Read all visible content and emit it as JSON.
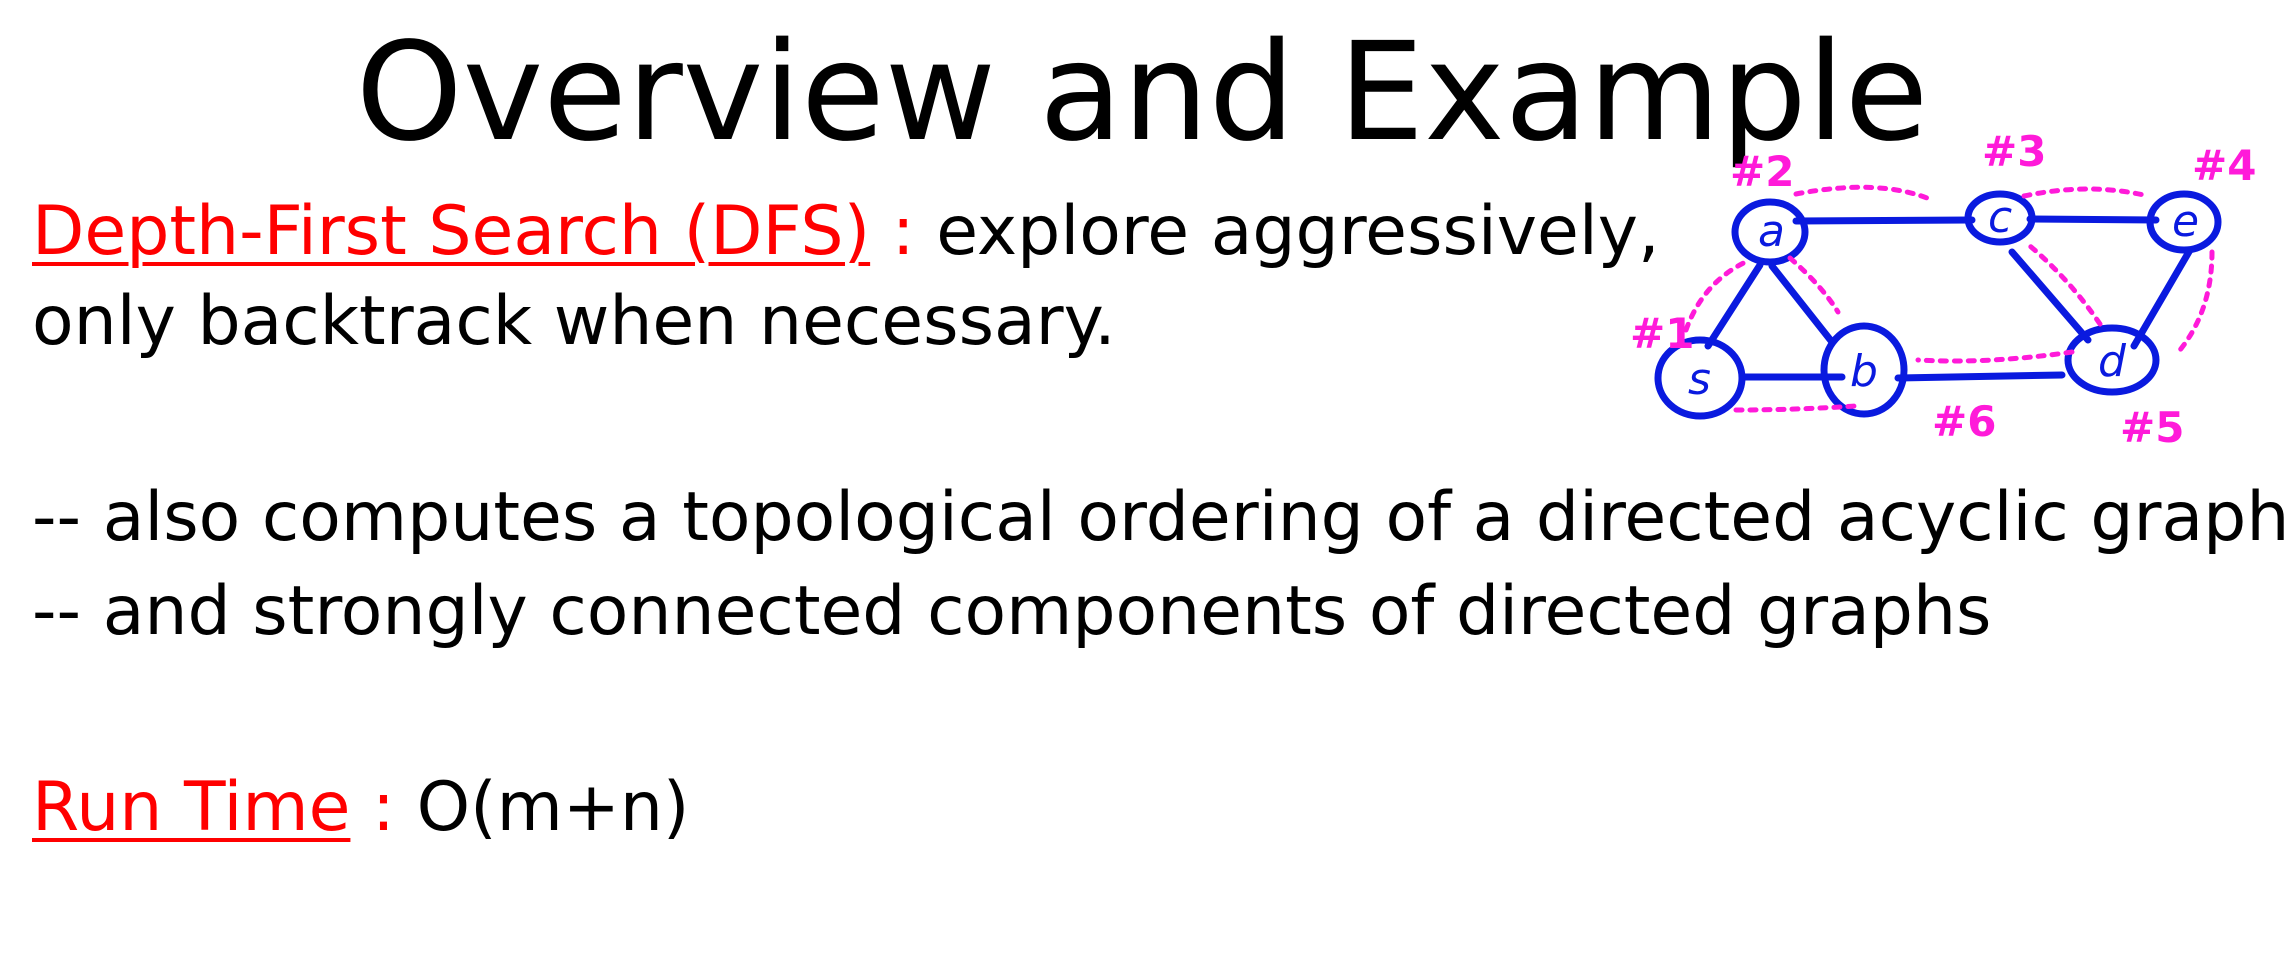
{
  "slide": {
    "title": "Overview and Example",
    "dfs_term": "Depth-First Search (DFS)",
    "dfs_colon": " : ",
    "dfs_desc_1": "explore aggressively,",
    "dfs_desc_2": "only backtrack when necessary.",
    "bullet_1": "-- also computes a topological ordering of a directed acyclic graph",
    "bullet_2": "-- and strongly connected components of directed graphs",
    "runtime_term": "Run Time",
    "runtime_colon": " : ",
    "runtime_value": "O(m+n)"
  },
  "sketch": {
    "node_labels": {
      "s": "s",
      "a": "a",
      "b": "b",
      "c": "c",
      "d": "d",
      "e": "e"
    },
    "order_labels": {
      "s": "#1",
      "a": "#2",
      "c": "#3",
      "e": "#4",
      "d": "#5",
      "b": "#6"
    }
  },
  "colors": {
    "accent": "#ff0000",
    "graph": "#0a1adf",
    "traversal": "#ff1ad9"
  }
}
